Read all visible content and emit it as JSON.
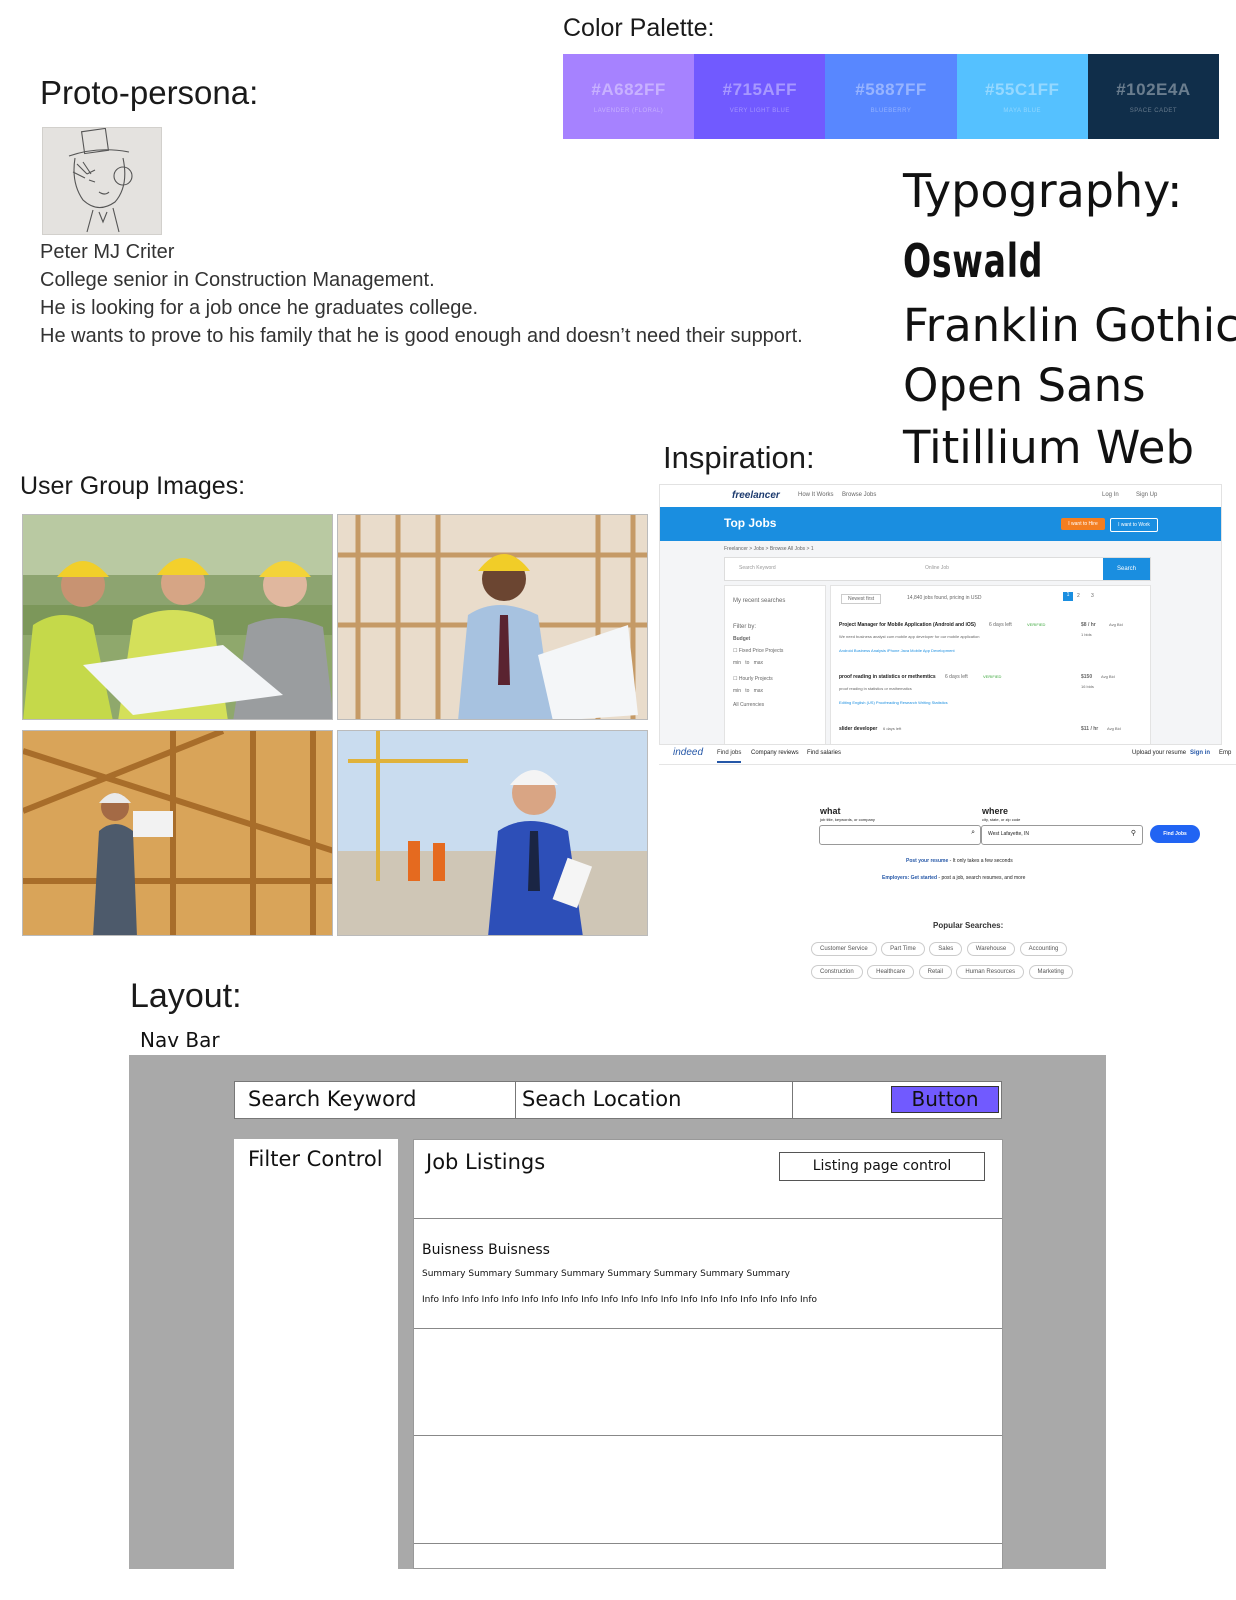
{
  "palette": {
    "title": "Color Palette:",
    "colors": [
      {
        "hex": "#A682FF",
        "name": "LAVENDER (FLORAL)"
      },
      {
        "hex": "#715AFF",
        "name": "VERY LIGHT BLUE"
      },
      {
        "hex": "#5887FF",
        "name": "BLUEBERRY"
      },
      {
        "hex": "#55C1FF",
        "name": "MAYA BLUE"
      },
      {
        "hex": "#102E4A",
        "name": "SPACE CADET"
      }
    ]
  },
  "persona": {
    "title": "Proto-persona:",
    "name": "Peter MJ Criter",
    "lines": [
      "College senior in Construction Management.",
      "He is looking for a job once he graduates college.",
      "He wants to prove to his family that he is good enough and doesn’t need their support."
    ]
  },
  "typography": {
    "title": "Typography:",
    "fonts": [
      "Oswald",
      "Franklin Gothic",
      "Open Sans",
      "Titillium Web"
    ]
  },
  "user_groups": {
    "title": "User Group Images:"
  },
  "inspiration": {
    "title": "Inspiration:",
    "freelancer": {
      "logo": "freelancer",
      "nav": [
        "How It Works",
        "Browse Jobs"
      ],
      "login": "Log In",
      "signup": "Sign Up",
      "heading": "Top Jobs",
      "btn_hire": "I want to Hire",
      "btn_work": "I want to Work",
      "breadcrumb": "Freelancer  >  Jobs  >  Browse All Jobs  >  1",
      "search_placeholder": "Search Keyword",
      "location_placeholder": "Online Job",
      "search_button": "Search",
      "recent": "My recent searches",
      "filter_by": "Filter by:",
      "budget": "Budget",
      "fixed": "Fixed Price Projects",
      "hourly": "Hourly Projects",
      "min": "min",
      "to": "to",
      "max": "max",
      "currencies": "All Currencies",
      "sort": "Newest first",
      "jobs_found": "14,840 jobs found, pricing in USD",
      "pages": [
        "1",
        "2",
        "3"
      ],
      "jobs": [
        {
          "title": "Project Manager for Mobile Application (Android and iOS)",
          "age": "6 days left",
          "badge": "VERIFIED",
          "price": "$8 / hr",
          "unit": "Avg Bid",
          "bids": "1 bids",
          "desc": "We need business analyst cum mobile app developer for our mobile application",
          "tags": "Android   Business Analysis   iPhone   Java   Mobile App Development"
        },
        {
          "title": "proof reading in statistics or methemtics",
          "age": "6 days left",
          "badge": "VERIFIED",
          "price": "$150",
          "unit": "Avg Bid",
          "bids": "16 bids",
          "desc": "proof reading in statistics or mathematics",
          "tags": "Editing   English (US)   Proofreading   Research Writing   Statistics"
        },
        {
          "title": "slider developer",
          "age": "6 days left",
          "badge": "",
          "price": "$11 / hr",
          "unit": "Avg Bid",
          "bids": "",
          "desc": "",
          "tags": ""
        }
      ]
    },
    "indeed": {
      "logo": "indeed",
      "tabs": [
        "Find jobs",
        "Company reviews",
        "Find salaries"
      ],
      "upload": "Upload your resume",
      "signin": "Sign in",
      "employers": "Emp",
      "what_label": "what",
      "what_hint": "job title, keywords, or company",
      "where_label": "where",
      "where_hint": "city, state, or zip code",
      "where_value": "West Lafayette, IN",
      "find_button": "Find Jobs",
      "post_resume_link": "Post your resume",
      "post_resume_text": " - It only takes a few seconds",
      "employers_link": "Employers: Get started",
      "employers_text": " - post a job, search resumes, and more",
      "popular_title": "Popular Searches:",
      "popular_row1": [
        "Customer Service",
        "Part Time",
        "Sales",
        "Warehouse",
        "Accounting"
      ],
      "popular_row2": [
        "Construction",
        "Healthcare",
        "Retail",
        "Human Resources",
        "Marketing"
      ]
    }
  },
  "layout": {
    "title": "Layout:",
    "navbar_label": "Nav Bar",
    "search_keyword": "Search Keyword",
    "search_location": "Seach Location",
    "button": "Button",
    "filter_control": "Filter Control",
    "job_listings": "Job Listings",
    "page_control": "Listing page control",
    "listing": {
      "business": "Buisness Buisness",
      "summary": "Summary Summary Summary Summary Summary Summary Summary Summary",
      "info": "Info Info Info Info Info Info Info Info Info Info Info Info Info Info Info Info Info Info Info Info"
    },
    "button_color": "#715AFF"
  }
}
